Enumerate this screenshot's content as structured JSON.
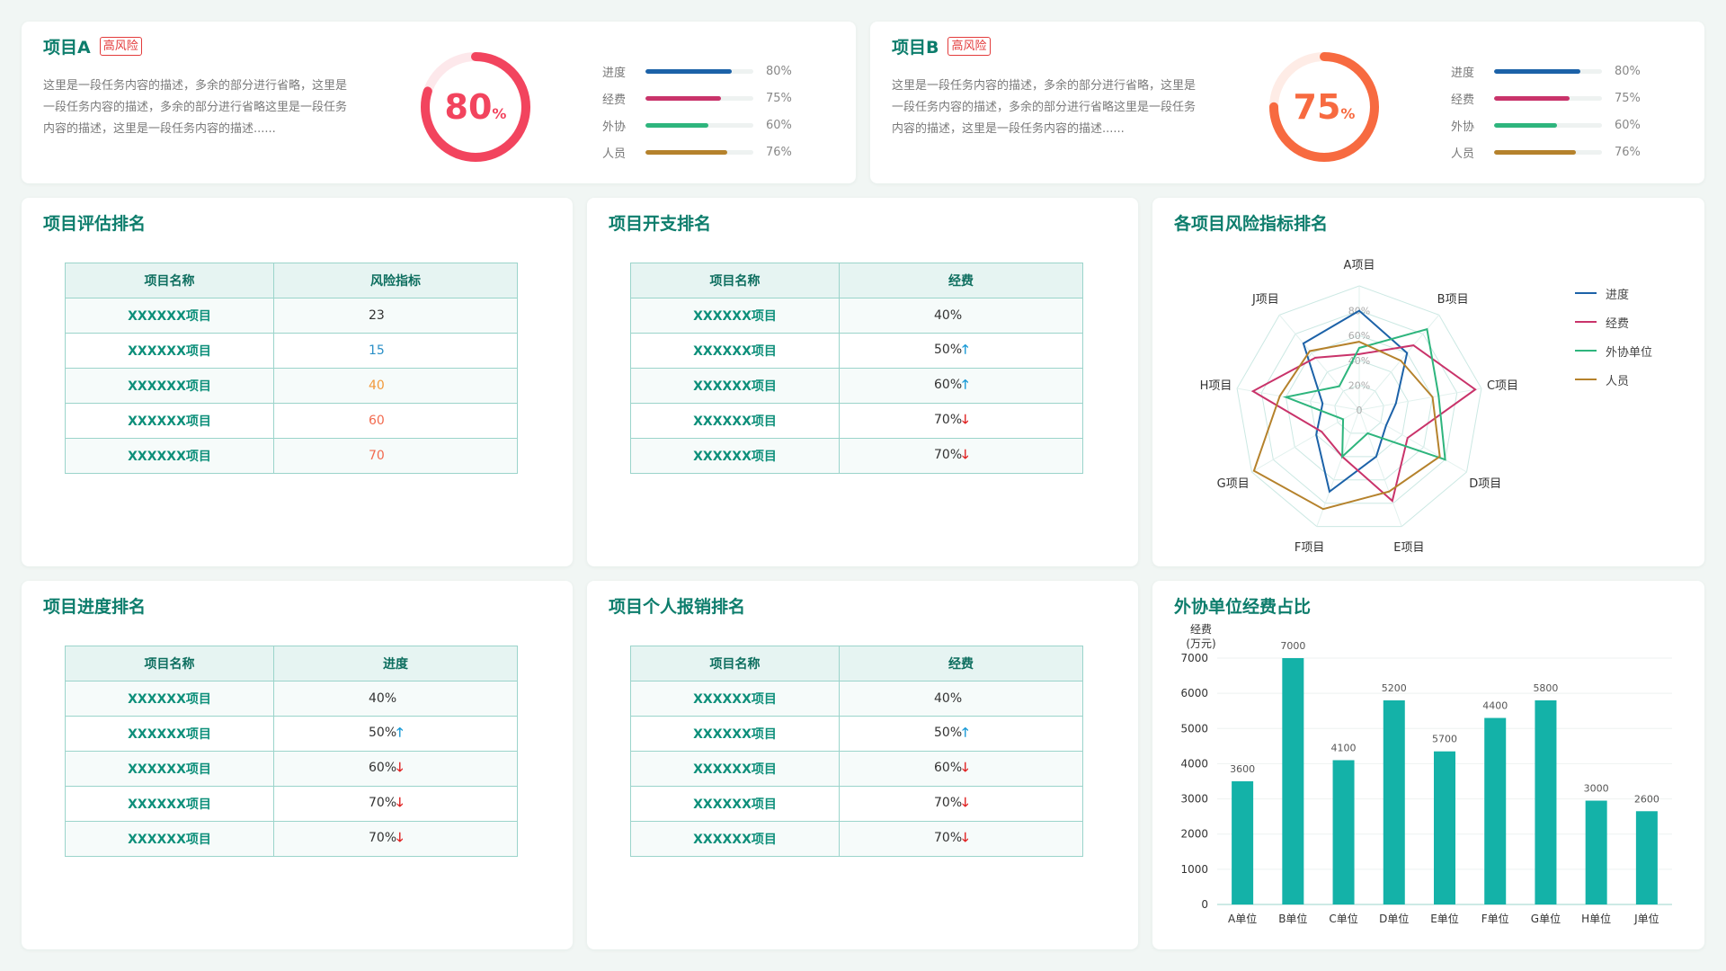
{
  "project_cards": [
    {
      "name": "项目A",
      "risk": "高风险",
      "desc": "这里是一段任务内容的描述，多余的部分进行省略，这里是一段任务内容的描述，多余的部分进行省略这里是一段任务内容的描述，这里是一段任务内容的描述......",
      "percent": 80,
      "percent_text": "80",
      "percent_unit": "%",
      "ring_color": "#f2445e",
      "ring_track": "#fde8eb",
      "metrics": [
        {
          "label": "进度",
          "value": "80%",
          "fraction": 0.8,
          "color": "#1c62a8"
        },
        {
          "label": "经费",
          "value": "75%",
          "fraction": 0.7,
          "color": "#c9336a"
        },
        {
          "label": "外协",
          "value": "60%",
          "fraction": 0.58,
          "color": "#2eb57d"
        },
        {
          "label": "人员",
          "value": "76%",
          "fraction": 0.76,
          "color": "#b5822c"
        }
      ]
    },
    {
      "name": "项目B",
      "risk": "高风险",
      "desc": "这里是一段任务内容的描述，多余的部分进行省略，这里是一段任务内容的描述，多余的部分进行省略这里是一段任务内容的描述，这里是一段任务内容的描述......",
      "percent": 75,
      "percent_text": "75",
      "percent_unit": "%",
      "ring_color": "#f76a40",
      "ring_track": "#feece6",
      "metrics": [
        {
          "label": "进度",
          "value": "80%",
          "fraction": 0.8,
          "color": "#1c62a8"
        },
        {
          "label": "经费",
          "value": "75%",
          "fraction": 0.7,
          "color": "#c9336a"
        },
        {
          "label": "外协",
          "value": "60%",
          "fraction": 0.58,
          "color": "#2eb57d"
        },
        {
          "label": "人员",
          "value": "76%",
          "fraction": 0.76,
          "color": "#b5822c"
        }
      ]
    }
  ],
  "tables": [
    {
      "title": "项目评估排名",
      "col1": "项目名称",
      "col2": "风险指标",
      "rows": [
        {
          "name": "XXXXXX项目",
          "value": "23",
          "color": "#333333",
          "trend": ""
        },
        {
          "name": "XXXXXX项目",
          "value": "15",
          "color": "#2a8fc7",
          "trend": ""
        },
        {
          "name": "XXXXXX项目",
          "value": "40",
          "color": "#f29a3c",
          "trend": ""
        },
        {
          "name": "XXXXXX项目",
          "value": "60",
          "color": "#f26a4f",
          "trend": ""
        },
        {
          "name": "XXXXXX项目",
          "value": "70",
          "color": "#f26a4f",
          "trend": ""
        }
      ]
    },
    {
      "title": "项目开支排名",
      "col1": "项目名称",
      "col2": "经费",
      "rows": [
        {
          "name": "XXXXXX项目",
          "value": "40%",
          "color": "#333333",
          "trend": ""
        },
        {
          "name": "XXXXXX项目",
          "value": "50%",
          "color": "#333333",
          "trend": "up"
        },
        {
          "name": "XXXXXX项目",
          "value": "60%",
          "color": "#333333",
          "trend": "up"
        },
        {
          "name": "XXXXXX项目",
          "value": "70%",
          "color": "#333333",
          "trend": "down"
        },
        {
          "name": "XXXXXX项目",
          "value": "70%",
          "color": "#333333",
          "trend": "down"
        }
      ]
    },
    {
      "title": "项目进度排名",
      "col1": "项目名称",
      "col2": "进度",
      "rows": [
        {
          "name": "XXXXXX项目",
          "value": "40%",
          "color": "#333333",
          "trend": ""
        },
        {
          "name": "XXXXXX项目",
          "value": "50%",
          "color": "#333333",
          "trend": "up"
        },
        {
          "name": "XXXXXX项目",
          "value": "60%",
          "color": "#333333",
          "trend": "down"
        },
        {
          "name": "XXXXXX项目",
          "value": "70%",
          "color": "#333333",
          "trend": "down"
        },
        {
          "name": "XXXXXX项目",
          "value": "70%",
          "color": "#333333",
          "trend": "down"
        }
      ]
    },
    {
      "title": "项目个人报销排名",
      "col1": "项目名称",
      "col2": "经费",
      "rows": [
        {
          "name": "XXXXXX项目",
          "value": "40%",
          "color": "#333333",
          "trend": ""
        },
        {
          "name": "XXXXXX项目",
          "value": "50%",
          "color": "#333333",
          "trend": "up"
        },
        {
          "name": "XXXXXX项目",
          "value": "60%",
          "color": "#333333",
          "trend": "down"
        },
        {
          "name": "XXXXXX项目",
          "value": "70%",
          "color": "#333333",
          "trend": "down"
        },
        {
          "name": "XXXXXX项目",
          "value": "70%",
          "color": "#333333",
          "trend": "down"
        }
      ]
    }
  ],
  "arrows": {
    "up": "🡑",
    "down": "🡓"
  },
  "radar_title": "各项目风险指标排名",
  "bar_title": "外协单位经费占比",
  "chart_data": [
    {
      "type": "radar",
      "title": "各项目风险指标排名",
      "categories": [
        "A项目",
        "B项目",
        "C项目",
        "D项目",
        "E项目",
        "F项目",
        "G项目",
        "H项目",
        "J项目"
      ],
      "rings": [
        "0",
        "20%",
        "40%",
        "60%",
        "80%"
      ],
      "max": 100,
      "series": [
        {
          "name": "进度",
          "color": "#1c62a8",
          "values": [
            80,
            60,
            30,
            25,
            40,
            70,
            40,
            30,
            70
          ]
        },
        {
          "name": "经费",
          "color": "#c9336a",
          "values": [
            45,
            68,
            95,
            45,
            78,
            40,
            35,
            87,
            55
          ]
        },
        {
          "name": "外协单位",
          "color": "#2eb57d",
          "values": [
            50,
            85,
            65,
            80,
            20,
            40,
            15,
            60,
            25
          ]
        },
        {
          "name": "人员",
          "color": "#b5822c",
          "values": [
            55,
            52,
            60,
            75,
            70,
            85,
            98,
            65,
            62
          ]
        }
      ]
    },
    {
      "type": "bar",
      "title": "外协单位经费占比",
      "ylabel_line1": "经费",
      "ylabel_line2": "(万元)",
      "categories": [
        "A单位",
        "B单位",
        "C单位",
        "D单位",
        "E单位",
        "F单位",
        "G单位",
        "H单位",
        "J单位"
      ],
      "values": [
        3500,
        7000,
        4100,
        5800,
        4350,
        5300,
        5800,
        2950,
        2650
      ],
      "labels": [
        "3600",
        "7000",
        "4100",
        "5200",
        "5700",
        "4400",
        "5800",
        "3000",
        "2600"
      ],
      "ylim": [
        0,
        7000
      ],
      "yticks": [
        "0",
        "1000",
        "2000",
        "3000",
        "4000",
        "5000",
        "6000",
        "7000"
      ],
      "color": "#14b2a8"
    }
  ]
}
